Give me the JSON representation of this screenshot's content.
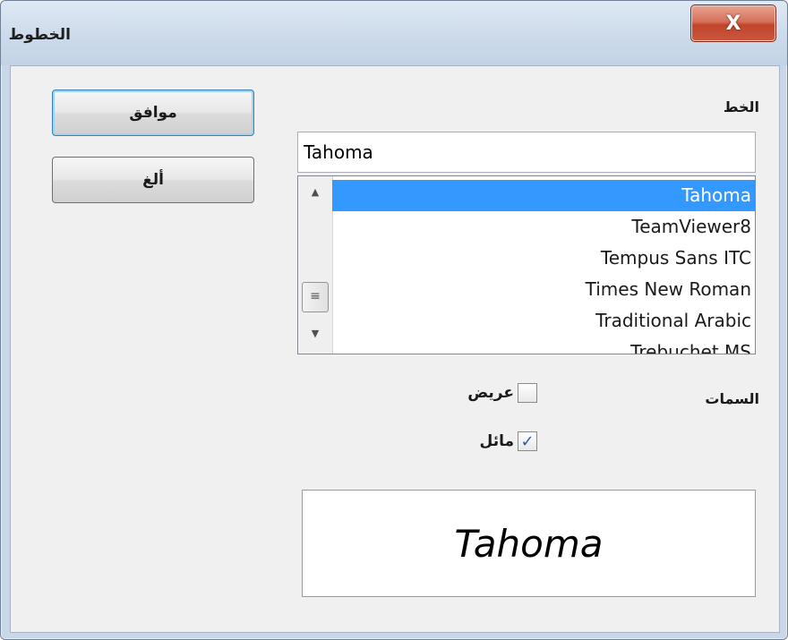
{
  "window": {
    "title": "الخطوط",
    "close_glyph": "X"
  },
  "font": {
    "label": "الخط",
    "value": "Tahoma",
    "list": [
      {
        "name": "Tahoma",
        "selected": true
      },
      {
        "name": "TeamViewer8",
        "selected": false
      },
      {
        "name": "Tempus Sans ITC",
        "selected": false
      },
      {
        "name": "Times New Roman",
        "selected": false
      },
      {
        "name": "Traditional Arabic",
        "selected": false
      },
      {
        "name": "Trebuchet MS",
        "selected": false
      }
    ]
  },
  "attributes": {
    "label": "السمات",
    "bold": {
      "label": "عريض",
      "checked": false
    },
    "italic": {
      "label": "مائل",
      "checked": true
    }
  },
  "buttons": {
    "ok": "موافق",
    "cancel": "ألغ"
  },
  "preview": {
    "text": "Tahoma"
  },
  "colors": {
    "selection": "#3399ff",
    "close_button": "#c2452a"
  }
}
